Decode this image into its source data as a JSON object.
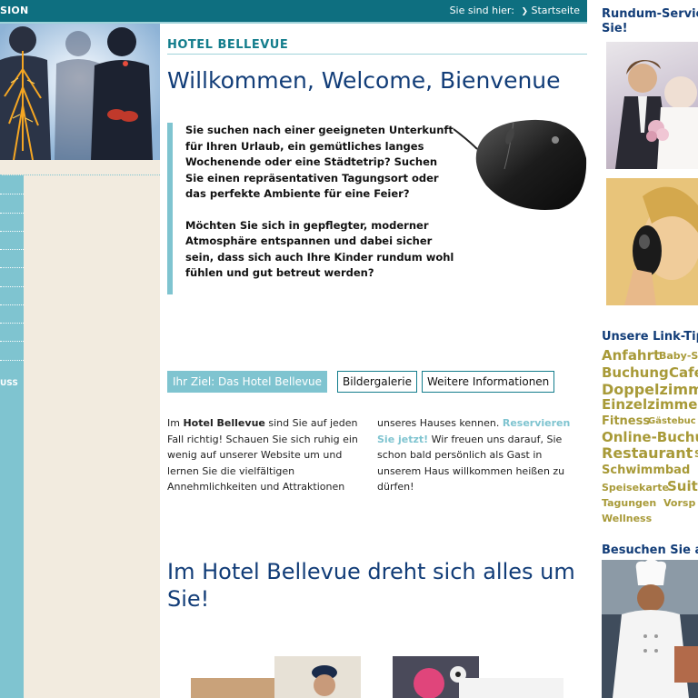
{
  "topbar": {
    "version_label": "SION",
    "breadcrumb_prefix": "Sie sind hier:",
    "breadcrumb_link": "Startseite"
  },
  "sidebar": {
    "partial_label": "USS"
  },
  "main": {
    "brand": "HOTEL BELLEVUE",
    "heading": "Willkommen, Welcome, Bienvenue",
    "intro_p1": "Sie suchen nach einer geeigneten Unterkunft für Ihren Urlaub, ein gemütliches langes Wochenende oder eine Städtetrip? Suchen Sie einen repräsentativen Tagungsort oder das perfekte Ambiente für eine Feier?",
    "intro_p2": "Möchten Sie sich in gepflegter, moderner Atmosphäre entspannen und dabei sicher sein, dass sich auch Ihre Kinder rundum wohl fühlen und gut betreut werden?",
    "tabs": [
      "Ihr Ziel: Das Hotel Bellevue",
      "Bildergalerie",
      "Weitere Informationen"
    ],
    "col1_pre": "Im ",
    "col1_bold": "Hotel Bellevue",
    "col1_post": " sind Sie auf jeden Fall richtig! Schauen Sie sich ruhig ein wenig auf unserer Website um und lernen Sie die vielfältigen Annehmlichkeiten und Attraktionen",
    "col2_pre": "unseres Hauses kennen. ",
    "col2_link": "Reservieren Sie jetzt!",
    "col2_post": " Wir freuen uns darauf, Sie schon bald persönlich als Gast in unserem Haus willkommen heißen zu dürfen!",
    "heading2": "Im Hotel Bellevue dreht sich alles um Sie!"
  },
  "right": {
    "service_heading": "Rundum-Servic",
    "service_heading2": "Sie!",
    "links_heading": "Unsere Link-Tip",
    "tags": [
      {
        "text": "Anfahrt",
        "size": 15
      },
      {
        "text": "Baby-S",
        "size": 11
      },
      {
        "text": "Buchung",
        "size": 15
      },
      {
        "text": "Café",
        "size": 15
      },
      {
        "text": "Doppelzimme",
        "size": 16
      },
      {
        "text": "Einzelzimmer",
        "size": 15
      },
      {
        "text": "Fitness",
        "size": 13
      },
      {
        "text": "Gästebuc",
        "size": 10
      },
      {
        "text": "Online-Buchu",
        "size": 15
      },
      {
        "text": "Restaurant",
        "size": 16
      },
      {
        "text": "S",
        "size": 11
      },
      {
        "text": "Schwimmbad",
        "size": 13
      },
      {
        "text": "Speisekarte",
        "size": 11
      },
      {
        "text": "Suite",
        "size": 15
      },
      {
        "text": "Tagungen",
        "size": 11
      },
      {
        "text": "Vorsp",
        "size": 11
      },
      {
        "text": "Wellness",
        "size": 11
      }
    ],
    "visit_heading": "Besuchen Sie a"
  },
  "colors": {
    "teal": "#0e6f80",
    "light_teal": "#7fc4d0",
    "navy": "#123d78",
    "olive": "#a89a38",
    "beige": "#f2ebdf"
  }
}
